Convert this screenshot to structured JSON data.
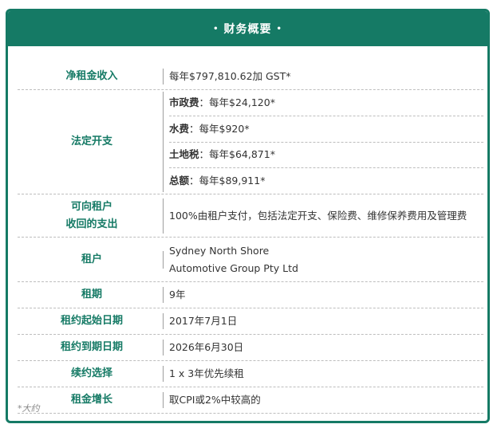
{
  "header": {
    "dot_left": "•",
    "title": "财务概要",
    "dot_right": "•"
  },
  "rows": [
    {
      "label": "净租金收入",
      "value": "每年$797,810.62加 GST*"
    },
    {
      "label": "法定开支",
      "items": [
        {
          "name": "市政费",
          "amount": "：每年$24,120*"
        },
        {
          "name": "水费",
          "amount": "：每年$920*"
        },
        {
          "name": "土地税",
          "amount": "：每年$64,871*"
        },
        {
          "name": "总额",
          "amount": "：每年$89,911*"
        }
      ]
    },
    {
      "label1": "可向租户",
      "label2": "收回的支出",
      "value": "100%由租户支付，包括法定开支、保险费、维修保养费用及管理费"
    },
    {
      "label": "租户",
      "value1": "Sydney North Shore",
      "value2": "Automotive Group Pty Ltd"
    },
    {
      "label": "租期",
      "value": "9年"
    },
    {
      "label": "租约起始日期",
      "value": "2017年7月1日"
    },
    {
      "label": "租约到期日期",
      "value": "2026年6月30日"
    },
    {
      "label": "续约选择",
      "value": "1 x 3年优先续租"
    },
    {
      "label": "租金增长",
      "value": "取CPI或2%中较高的"
    }
  ],
  "footnote": "*大约",
  "colors": {
    "accent": "#157a65"
  }
}
